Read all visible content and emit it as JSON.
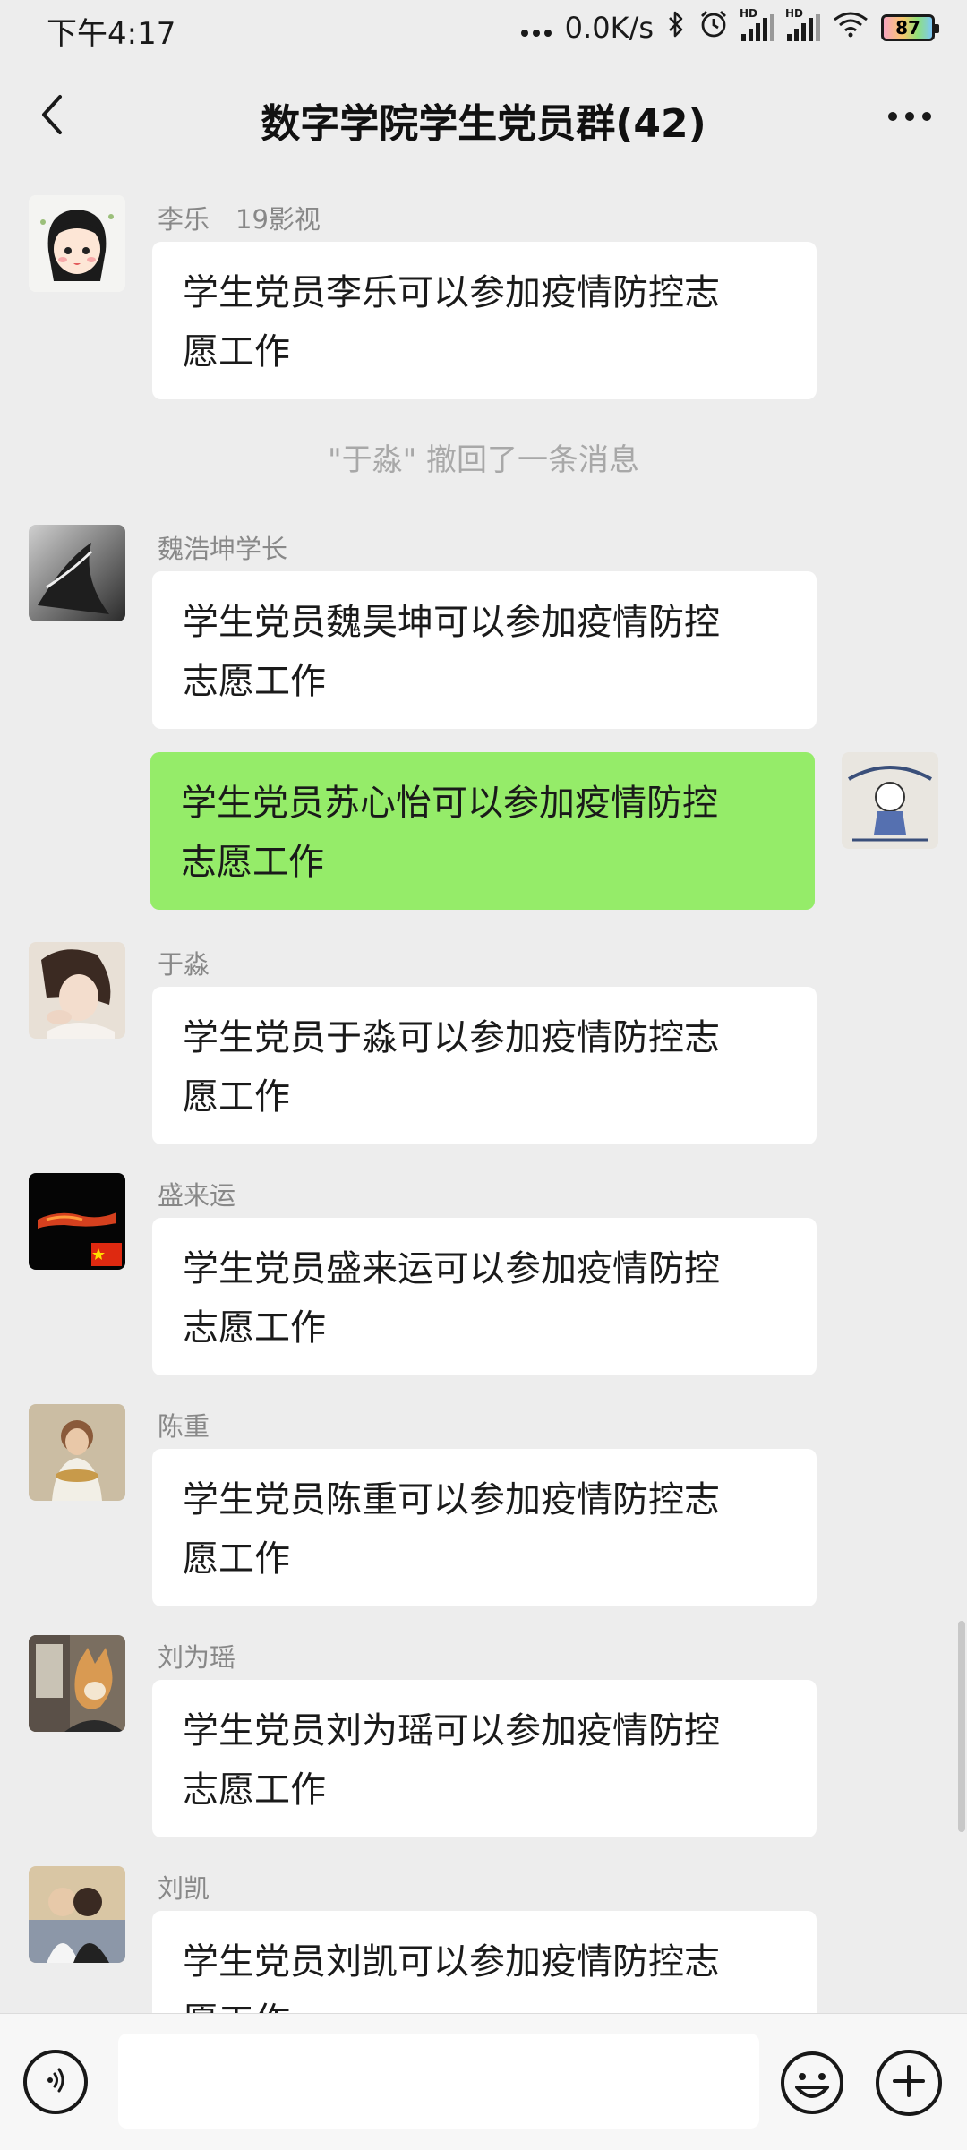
{
  "status_bar": {
    "time": "下午4:17",
    "network_speed": "0.0K/s",
    "signal_label_1": "HD",
    "signal_label_2": "HD",
    "battery": "87",
    "icons": [
      "dots-icon",
      "bluetooth-icon",
      "alarm-icon",
      "signal-icon",
      "signal-icon",
      "wifi-icon",
      "battery-icon"
    ]
  },
  "header": {
    "title": "数字学院学生党员群(42)",
    "back_icon": "chevron-left-icon",
    "more_icon": "more-dots-icon"
  },
  "messages": [
    {
      "sender": "李乐　19影视",
      "text": "学生党员李乐可以参加疫情防控志\n愿工作"
    },
    {
      "system": "\"于淼\" 撤回了一条消息"
    },
    {
      "sender": "魏浩坤学长",
      "text": "学生党员魏昊坤可以参加疫情防控\n志愿工作"
    },
    {
      "sender": "",
      "text": "学生党员苏心怡可以参加疫情防控\n志愿工作",
      "self": true
    },
    {
      "sender": "于淼",
      "text": "学生党员于淼可以参加疫情防控志\n愿工作"
    },
    {
      "sender": "盛来运",
      "text": "学生党员盛来运可以参加疫情防控\n志愿工作"
    },
    {
      "sender": "陈重",
      "text": "学生党员陈重可以参加疫情防控志\n愿工作"
    },
    {
      "sender": "刘为瑶",
      "text": "学生党员刘为瑶可以参加疫情防控\n志愿工作"
    },
    {
      "sender": "刘凯",
      "text": "学生党员刘凯可以参加疫情防控志\n愿工作"
    }
  ],
  "input_bar": {
    "voice_icon": "voice-icon",
    "input_value": "",
    "emoji_icon": "emoji-icon",
    "plus_icon": "plus-icon"
  },
  "colors": {
    "background": "#ededed",
    "bubble_other": "#ffffff",
    "bubble_self": "#95ec69",
    "sender_text": "#888888",
    "system_text": "#a8a8a8"
  }
}
